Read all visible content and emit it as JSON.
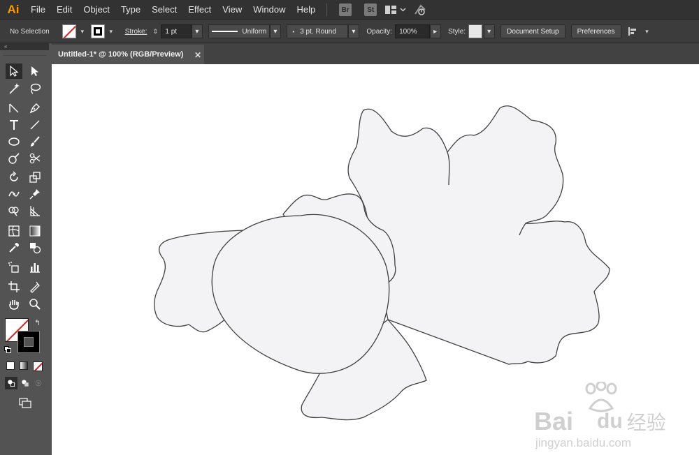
{
  "app": {
    "logo": "Ai"
  },
  "menu": [
    "File",
    "Edit",
    "Object",
    "Type",
    "Select",
    "Effect",
    "View",
    "Window",
    "Help"
  ],
  "app_buttons": {
    "bridge": "Br",
    "stock": "St"
  },
  "control_bar": {
    "selection_status": "No Selection",
    "stroke_label": "Stroke:",
    "stroke_weight": "1 pt",
    "variable_width": "Uniform",
    "brush": "3 pt. Round",
    "opacity_label": "Opacity:",
    "opacity_value": "100%",
    "style_label": "Style:",
    "document_setup": "Document Setup",
    "preferences": "Preferences"
  },
  "tab": {
    "title": "Untitled-1* @ 100% (RGB/Preview)",
    "close": "✕"
  },
  "watermark": {
    "brand": "Bai",
    "brand2": "du",
    "cn": "经验",
    "url": "jingyan.baidu.com"
  },
  "colors": {
    "accent": "#ff9a00",
    "shape_fill": "#f3f2f4",
    "shape_stroke": "#404040",
    "fill_none_slash": "#e01e1e"
  }
}
